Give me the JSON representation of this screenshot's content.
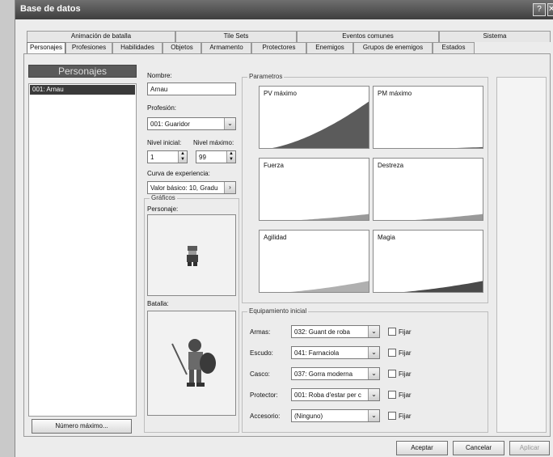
{
  "window": {
    "title": "Base de datos",
    "help_button": "?"
  },
  "tabs_top": [
    {
      "label": "Animación de batalla"
    },
    {
      "label": "Tile Sets"
    },
    {
      "label": "Eventos comunes"
    },
    {
      "label": "Sistema"
    }
  ],
  "tabs_bottom": [
    {
      "label": "Personajes"
    },
    {
      "label": "Profesiones"
    },
    {
      "label": "Habilidades"
    },
    {
      "label": "Objetos"
    },
    {
      "label": "Armamento"
    },
    {
      "label": "Protectores"
    },
    {
      "label": "Enemigos"
    },
    {
      "label": "Grupos de enemigos"
    },
    {
      "label": "Estados"
    }
  ],
  "list": {
    "header": "Personajes",
    "items": [
      {
        "label": "001: Arnau",
        "selected": true
      }
    ],
    "max_button": "Número máximo..."
  },
  "form": {
    "name_label": "Nombre:",
    "name_value": "Arnau",
    "class_label": "Profesión:",
    "class_value": "001: Guaridor",
    "initial_level_label": "Nivel inicial:",
    "initial_level_value": "1",
    "max_level_label": "Nivel máximo:",
    "max_level_value": "99",
    "exp_curve_label": "Curva de experiencia:",
    "exp_curve_value": "Valor básico: 10, Gradu",
    "graphics_group": "Gráficos",
    "character_label": "Personaje:",
    "battle_label": "Batalla:"
  },
  "parameters": {
    "group_title": "Parametros",
    "charts": [
      {
        "label": "PV máximo",
        "color": "#5b5b5b",
        "level": 0.95
      },
      {
        "label": "PM máximo",
        "color": "#5b5b5b",
        "level": 0.05
      },
      {
        "label": "Fuerza",
        "color": "#9a9a9a",
        "level": 0.15
      },
      {
        "label": "Destreza",
        "color": "#9a9a9a",
        "level": 0.15
      },
      {
        "label": "Agilidad",
        "color": "#b0b0b0",
        "level": 0.25
      },
      {
        "label": "Magia",
        "color": "#4a4a4a",
        "level": 0.25
      }
    ]
  },
  "equipment": {
    "group_title": "Equipamiento inicial",
    "fix_label": "Fijar",
    "rows": [
      {
        "label": "Armas:",
        "value": "032: Guant de roba"
      },
      {
        "label": "Escudo:",
        "value": "041: Farnaciola"
      },
      {
        "label": "Casco:",
        "value": "037: Gorra moderna"
      },
      {
        "label": "Protector:",
        "value": "001: Roba d'estar per c"
      },
      {
        "label": "Accesorio:",
        "value": "(Ninguno)"
      }
    ]
  },
  "buttons": {
    "ok": "Aceptar",
    "cancel": "Cancelar",
    "apply": "Aplicar"
  }
}
